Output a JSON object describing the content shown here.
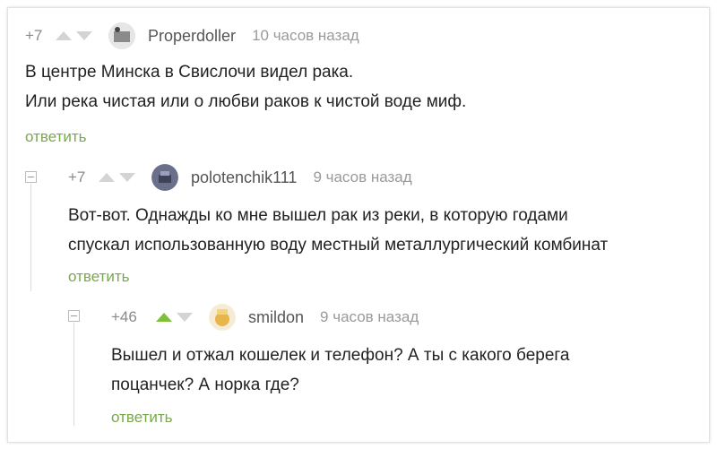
{
  "comments": [
    {
      "rating": "+7",
      "username": "Properdoller",
      "time": "10 часов назад",
      "lines": [
        "В центре Минска в Свислочи видел рака.",
        "Или река чистая или о любви раков к чистой воде миф."
      ],
      "reply": "ответить"
    },
    {
      "rating": "+7",
      "username": "polotenchik111",
      "time": "9 часов назад",
      "lines": [
        "Вот-вот. Однажды ко мне вышел рак из реки, в которую годами",
        "спускал использованную воду местный металлургический комбинат"
      ],
      "reply": "ответить"
    },
    {
      "rating": "+46",
      "username": "smildon",
      "time": "9 часов назад",
      "lines": [
        "Вышел и отжал кошелек и телефон?  А ты с какого берега",
        "поцанчек? А норка где?"
      ],
      "reply": "ответить"
    }
  ],
  "colors": {
    "reply": "#7aa84c",
    "upvote_active": "#7fbf3a",
    "muted": "#9a9a9a"
  },
  "icons": [
    "upvote-arrow-icon",
    "downvote-arrow-icon",
    "collapse-icon",
    "avatar"
  ]
}
